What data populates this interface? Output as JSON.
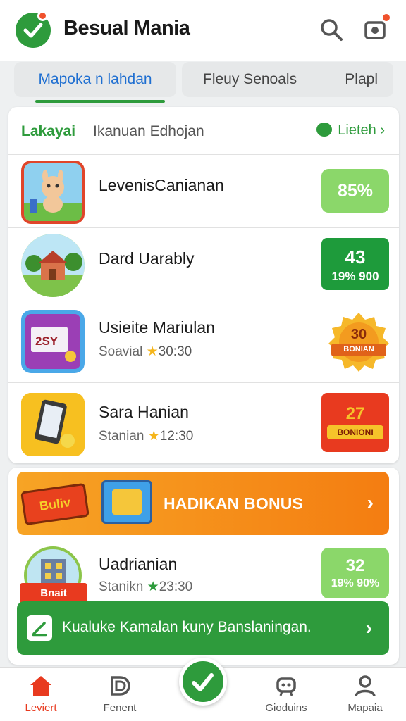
{
  "app": {
    "title": "Besual Mania"
  },
  "icons": {
    "search": "search-icon",
    "bag": "shopping-bag-icon",
    "logo": "check-logo-icon"
  },
  "colors": {
    "brand": "#2e9b3c",
    "accent": "#f0522d",
    "orange": "#f47d11",
    "tab_active": "#1f6fd1"
  },
  "tabs": [
    {
      "label": "Mapoka n lahdan",
      "active": true
    },
    {
      "label": "Fleuy Senoals",
      "active": false
    },
    {
      "label": "Plapl",
      "active": false
    }
  ],
  "list_header": {
    "title": "Lakayai",
    "subtitle": "Ikanuan Edhojan",
    "link": "Lieteh"
  },
  "rows": [
    {
      "name": "LevenisCanianan",
      "meta_label": "",
      "meta_value": "",
      "badge": "85%",
      "badge_sub": ""
    },
    {
      "name": "Dard Uarably",
      "meta_label": "",
      "meta_value": "",
      "badge": "43",
      "badge_sub": "19% 900"
    },
    {
      "name": "Usieite Mariulan",
      "meta_label": "Soavial",
      "meta_value": "30:30",
      "badge": "30",
      "badge_sub": "BONIAN"
    },
    {
      "name": "Sara Hanian",
      "meta_label": "Stanian",
      "meta_value": "12:30",
      "badge": "27",
      "badge_sub": "BONIONI"
    }
  ],
  "bonus": {
    "label": "HADIKAN BONUS",
    "sign_text": "Buliv"
  },
  "row5": {
    "name": "Uadrianian",
    "meta_label": "Stanikn",
    "meta_value": "23:30",
    "badge": "32",
    "badge_sub": "19% 90%",
    "sign_text": "Bnait"
  },
  "cta": {
    "label": "Kualuke Kamalan kuny Banslaningan."
  },
  "bottom_nav": [
    {
      "label": "Leviert",
      "icon": "home-icon",
      "active": true
    },
    {
      "label": "Fenent",
      "icon": "d-icon",
      "active": false
    },
    {
      "label": "Gioduins",
      "icon": "robot-icon",
      "active": false
    },
    {
      "label": "Mapaia",
      "icon": "user-icon",
      "active": false
    }
  ]
}
